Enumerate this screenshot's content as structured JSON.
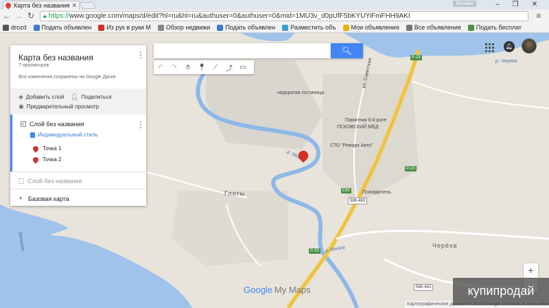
{
  "browser": {
    "tab_title": "Карта без названия",
    "user_label": "Михаил",
    "url_scheme": "https://",
    "url_rest": "www.google.com/maps/d/edit?hl=ru&hl=ru&authuser=0&authuser=0&mid=1MU3v_d0pUfF5bKYUYiFmFHH9AKI",
    "bookmarks": [
      {
        "label": "drozd",
        "color": "#555555"
      },
      {
        "label": "Подать объявлен",
        "color": "#3a7bd5"
      },
      {
        "label": "Из рук в руки М",
        "color": "#d62f24"
      },
      {
        "label": "Обзор недвижи",
        "color": "#888888"
      },
      {
        "label": "Подать объявлен",
        "color": "#3a7bd5"
      },
      {
        "label": "Разместить объ",
        "color": "#3aa0d5"
      },
      {
        "label": "Мои объявления",
        "color": "#e8b000"
      },
      {
        "label": "Все объявления",
        "color": "#777777"
      },
      {
        "label": "Подать бесплат",
        "color": "#4c8f47"
      }
    ]
  },
  "panel": {
    "map_title": "Карта без названия",
    "views": "7 просмотров",
    "saved_status": "Все изменения сохранены на Google Диске",
    "add_layer": "Добавить слой",
    "share": "Поделиться",
    "preview": "Предварительный просмотр",
    "layer1": {
      "name": "Слой без названия",
      "style": "Индивидуальный стиль",
      "points": [
        "Точка 1",
        "Точка 2"
      ]
    },
    "layer2": {
      "name": "Слой без названия"
    },
    "basemap": "Базовая карта"
  },
  "map": {
    "labels": {
      "river_chereha_top": "р. Череха",
      "river_mnoga_mid": "р. Многа",
      "river_mnoga_low": "р. Многа",
      "street": "ул. Советская",
      "hotel": "недорогая гостиница",
      "monument": "Памятник 6-й роте",
      "pskov_med": "ПСКОВСКИЙ МЁД",
      "sto": "СТО \"Ремарк Авто\"",
      "pskovdizel": "Псковдизель",
      "village_gloty": "Глоты",
      "village_chereha": "Черёха",
      "velikaya": "Великая"
    },
    "shields": {
      "r23a": "Р-23",
      "r23b": "Р-23",
      "r23c": "Р-23",
      "e95": "E95",
      "road463a": "58К-463",
      "road463b": "58К-463"
    },
    "logo_text": "Google",
    "logo_product": "My Maps",
    "footer": "Картографические данные © 2016 Google    Условия использования",
    "watermark": "купипродай",
    "zoom_in": "+",
    "zoom_out": "−"
  }
}
